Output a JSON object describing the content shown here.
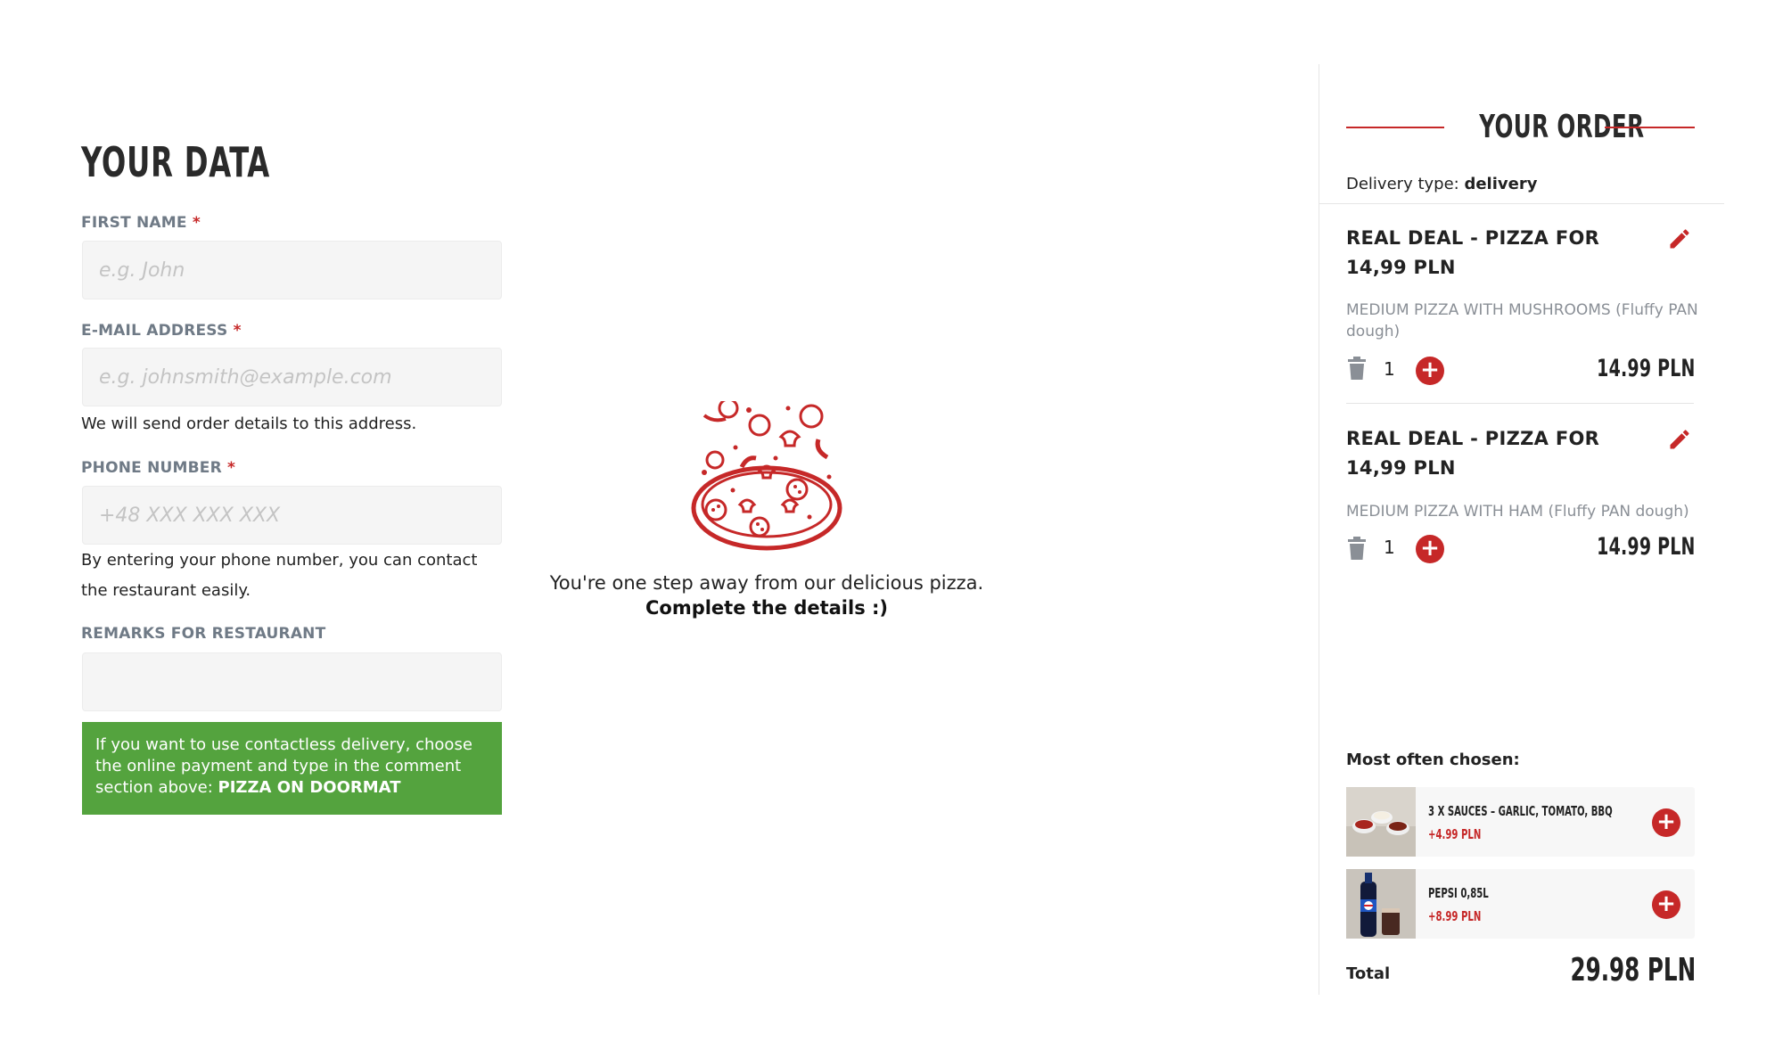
{
  "form": {
    "title": "YOUR DATA",
    "first_name_label": "FIRST NAME",
    "first_name_placeholder": "e.g. John",
    "email_label": "E-MAIL ADDRESS",
    "email_placeholder": "e.g. johnsmith@example.com",
    "email_help": "We will send order details to this address.",
    "phone_label": "PHONE NUMBER",
    "phone_placeholder": "+48 XXX XXX XXX",
    "phone_help": "By entering your phone number, you can contact the restaurant easily.",
    "remarks_label": "REMARKS FOR RESTAURANT",
    "remarks_value": "",
    "required_marker": "*",
    "notice_text": "If you want to use contactless delivery, choose the online payment and type in the comment section above: ",
    "notice_bold": "PIZZA ON DOORMAT"
  },
  "center": {
    "message_line1": "You're one step away from our delicious pizza.",
    "message_line2": "Complete the details :)"
  },
  "order": {
    "title": "YOUR ORDER",
    "delivery_label": "Delivery type:",
    "delivery_value": "delivery",
    "items": [
      {
        "title": "REAL DEAL - PIZZA FOR 14,99 PLN",
        "description": "MEDIUM PIZZA WITH MUSHROOMS (Fluffy PAN dough)",
        "quantity": "1",
        "price": "14.99 PLN"
      },
      {
        "title": "REAL DEAL - PIZZA FOR 14,99 PLN",
        "description": "MEDIUM PIZZA WITH HAM (Fluffy PAN dough)",
        "quantity": "1",
        "price": "14.99 PLN"
      }
    ],
    "most_chosen_label": "Most often chosen:",
    "upsells": [
      {
        "name": "3 X SAUCES – GARLIC, TOMATO, BBQ",
        "price": "+4.99 PLN"
      },
      {
        "name": "PEPSI 0,85L",
        "price": "+8.99 PLN"
      }
    ],
    "total_label": "Total",
    "total_value": "29.98 PLN"
  },
  "colors": {
    "accent": "#c62828",
    "notice_bg": "#54a33e",
    "label_gray": "#6f7a86"
  },
  "icons": [
    "pencil-icon",
    "trash-icon",
    "plus-icon",
    "pizza-illustration"
  ]
}
